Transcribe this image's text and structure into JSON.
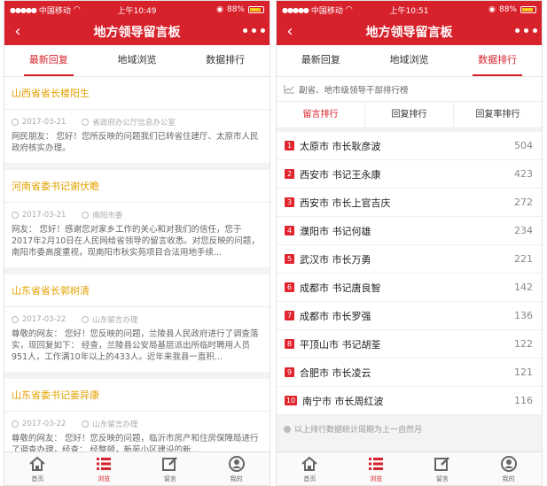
{
  "status_left": {
    "carrier": "中国移动",
    "time": "上午10:49",
    "battery": "88%"
  },
  "status_right": {
    "carrier": "中国移动",
    "time": "上午10:51",
    "battery": "88%"
  },
  "nav": {
    "back": "‹",
    "title": "地方领导留言板",
    "more": "•••"
  },
  "tabs": [
    "最新回复",
    "地域浏览",
    "数据排行"
  ],
  "messages": [
    {
      "title": "山西省省长楼阳生",
      "date": "2017-03-21",
      "source": "省政府办公厅信息办公室",
      "body": "网民朋友：  您好！您所反映的问题我们已转省住建厅、太原市人民政府核实办理。"
    },
    {
      "title": "河南省委书记谢伏瞻",
      "date": "2017-03-21",
      "source": "南阳市委",
      "body": "网友：  您好！感谢您对家乡工作的关心和对我们的信任，您于2017年2月10日在人民网给省领导的留言收悉。对您反映的问题，南阳市委高度重视，现南阳市秋实苑项目合法用地手续..."
    },
    {
      "title": "山东省省长郭树清",
      "date": "2017-03-22",
      "source": "山东留言办理",
      "body": "尊敬的网友：  您好！您反映的问题，兰陵县人民政府进行了调查落实，现回复如下：  经查，兰陵县公安局基层派出所临时聘用人员951人，工作满10年以上的433人。近年来我县一直积..."
    },
    {
      "title": "山东省委书记姜异康",
      "date": "2017-03-22",
      "source": "山东留言办理",
      "body": "尊敬的网友：  您好！您反映的问题，临沂市房产和住房保障局进行了调查办理，经查：  经整顿，新苑小区建设的新..."
    }
  ],
  "ranking": {
    "header": "副省、地市级领导干部排行榜",
    "subtabs": [
      "留言排行",
      "回复排行",
      "回复率排行"
    ],
    "rows": [
      {
        "rank": "1",
        "name": "太原市 市长耿彦波",
        "count": "504"
      },
      {
        "rank": "2",
        "name": "西安市 书记王永康",
        "count": "423"
      },
      {
        "rank": "3",
        "name": "西安市 市长上官吉庆",
        "count": "272"
      },
      {
        "rank": "4",
        "name": "濮阳市 书记何雄",
        "count": "234"
      },
      {
        "rank": "5",
        "name": "武汉市 市长万勇",
        "count": "221"
      },
      {
        "rank": "6",
        "name": "成都市 书记唐良智",
        "count": "142"
      },
      {
        "rank": "7",
        "name": "成都市 市长罗强",
        "count": "136"
      },
      {
        "rank": "8",
        "name": "平顶山市 书记胡荃",
        "count": "122"
      },
      {
        "rank": "9",
        "name": "合肥市 市长凌云",
        "count": "121"
      },
      {
        "rank": "10",
        "name": "南宁市 市长周红波",
        "count": "116"
      }
    ],
    "note": "以上排行数据统计周期为上一自然月"
  },
  "bottom_nav": [
    "首页",
    "浏览",
    "留言",
    "我的"
  ],
  "colors": {
    "brand": "#d7222c",
    "title_orange": "#e3a100"
  }
}
